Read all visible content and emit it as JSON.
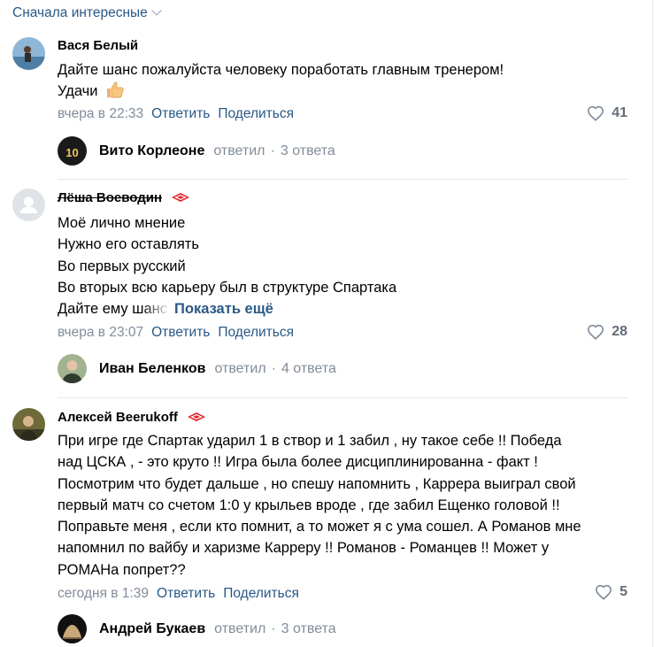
{
  "sort": {
    "label": "Сначала интересные"
  },
  "comments": [
    {
      "author": "Вася Белый",
      "lines": [
        "Дайте шанс пожалуйста человеку поработать главным тренером!",
        "Удачи"
      ],
      "time": "вчера в 22:33",
      "reply_label": "Ответить",
      "share_label": "Поделиться",
      "likes": "41",
      "thread": {
        "name": "Вито Корлеоне",
        "action": "ответил",
        "count": "3 ответа",
        "jersey_number": "10"
      }
    },
    {
      "author": "Лёша Воеводин",
      "lines": [
        "Моё лично мнение",
        "Нужно его оставлять",
        "Во первых русский",
        "Во вторых всю карьеру был в структуре Спартака"
      ],
      "last_line_start": "Дайте ему шанс",
      "show_more": "Показать ещё",
      "time": "вчера в 23:07",
      "reply_label": "Ответить",
      "share_label": "Поделиться",
      "likes": "28",
      "thread": {
        "name": "Иван Беленков",
        "action": "ответил",
        "count": "4 ответа"
      }
    },
    {
      "author": "Алексей Beerukoff",
      "lines": [
        "При игре где Спартак ударил 1 в створ и 1 забил , ну такое себе !! Победа",
        "над ЦСКА , - это круто !! Игра была более дисциплинированна - факт !",
        "Посмотрим что будет дальше , но спешу напомнить , Каррера выиграл свой",
        "первый матч со счетом 1:0 у крыльев вроде , где забил Ещенко головой !!",
        "Поправьте меня , если кто помнит, а то может я с ума сошел. А Романов мне",
        "напомнил по вайбу и харизме Карреру !! Романов - Романцев !! Может у",
        "РОМАНа попрет??"
      ],
      "time": "сегодня в 1:39",
      "reply_label": "Ответить",
      "share_label": "Поделиться",
      "likes": "5",
      "thread": {
        "name": "Андрей Букаев",
        "action": "ответил",
        "count": "3 ответа"
      }
    }
  ],
  "colors": {
    "link": "#2a5885",
    "meta": "#818c99",
    "badge": "#e1252b"
  }
}
